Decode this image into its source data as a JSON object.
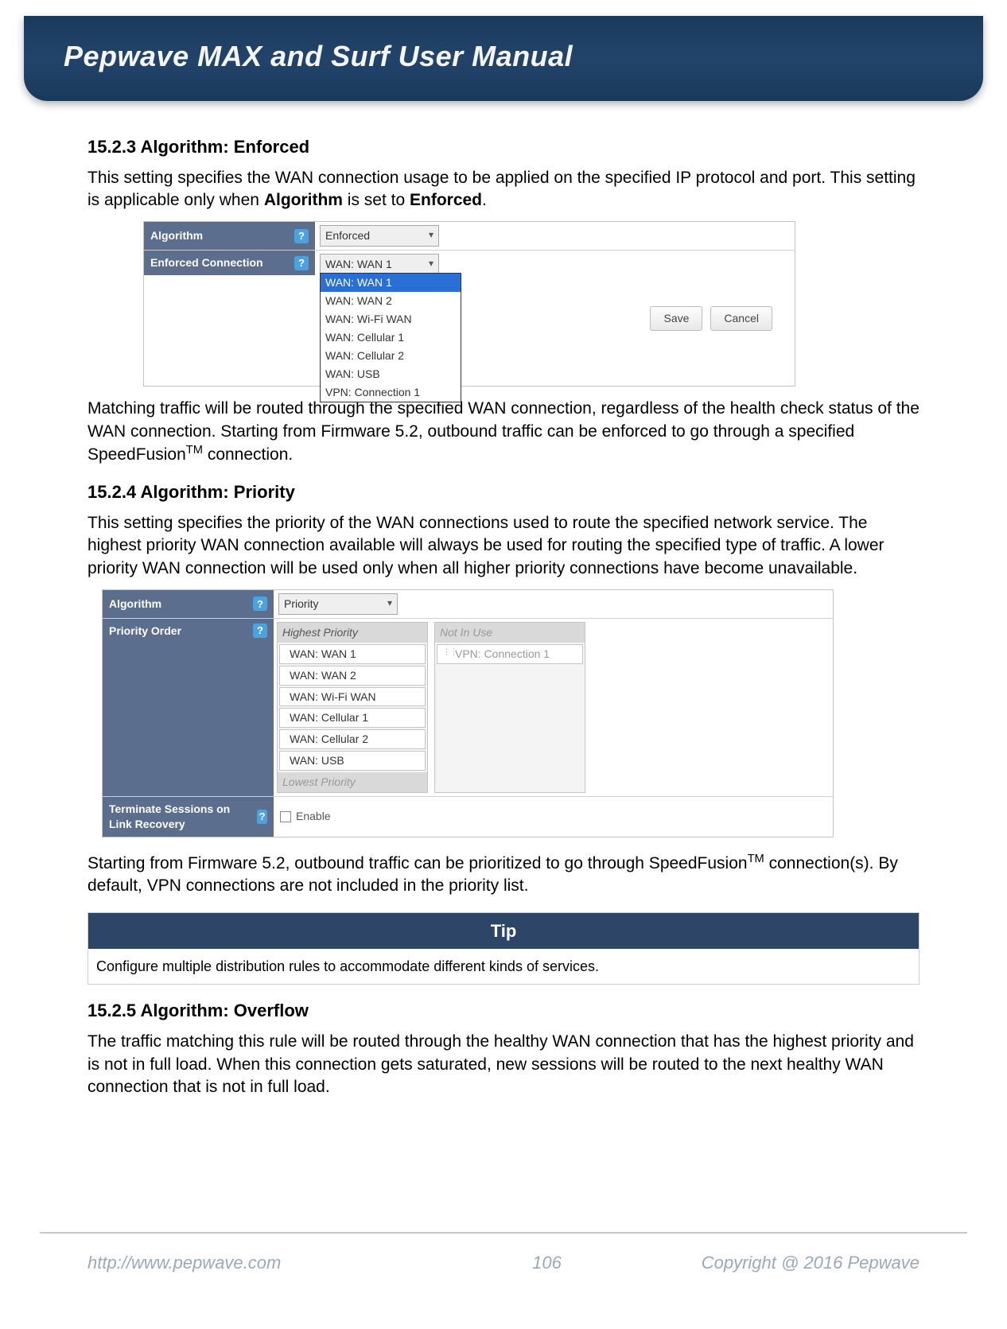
{
  "header": {
    "title": "Pepwave MAX and Surf User Manual"
  },
  "sections": {
    "s1": {
      "heading": "15.2.3 Algorithm: Enforced",
      "p1a": "This setting specifies the WAN connection usage to be applied on the specified IP protocol and port. This setting is applicable only when ",
      "p1b": "Algorithm",
      "p1c": " is set to ",
      "p1d": "Enforced",
      "p1e": ".",
      "p2a": "Matching traffic will be routed through the specified WAN connection, regardless of the health check status of the WAN connection. Starting from Firmware 5.2, outbound traffic can be enforced to go through a specified SpeedFusion",
      "p2b": " connection."
    },
    "s2": {
      "heading": "15.2.4 Algorithm: Priority",
      "p1": "This setting specifies the priority of the WAN connections used to route the specified network service. The highest priority WAN connection available will always be used for routing the specified type of traffic. A lower priority WAN connection will be used only when all higher priority connections have become unavailable.",
      "p2a": "Starting from Firmware 5.2, outbound traffic can be prioritized to go through SpeedFusion",
      "p2b": " connection(s). By default, VPN connections are not included in the priority list."
    },
    "s3": {
      "heading": "15.2.5 Algorithm: Overflow",
      "p1": "The traffic matching this rule will be routed through the healthy WAN connection that has the highest priority and is not in full load. When this connection gets saturated, new sessions will be routed to the next healthy WAN connection that is not in full load."
    }
  },
  "shot1": {
    "row_algo": "Algorithm",
    "row_enf": "Enforced Connection",
    "algo_value": "Enforced",
    "enf_value": "WAN: WAN 1",
    "options": [
      "WAN: WAN 1",
      "WAN: WAN 2",
      "WAN: Wi-Fi WAN",
      "WAN: Cellular 1",
      "WAN: Cellular 2",
      "WAN: USB",
      "VPN: Connection 1"
    ],
    "save": "Save",
    "cancel": "Cancel",
    "help_glyph": "?"
  },
  "shot2": {
    "row_algo": "Algorithm",
    "algo_value": "Priority",
    "row_prio": "Priority Order",
    "highest": "Highest Priority",
    "lowest": "Lowest Priority",
    "notinuse": "Not In Use",
    "items": [
      "WAN: WAN 1",
      "WAN: WAN 2",
      "WAN: Wi-Fi WAN",
      "WAN: Cellular 1",
      "WAN: Cellular 2",
      "WAN: USB"
    ],
    "niu_items": [
      "VPN: Connection 1"
    ],
    "row_term": "Terminate Sessions on Link Recovery",
    "enable": "Enable"
  },
  "tip": {
    "title": "Tip",
    "body": "Configure multiple distribution rules to accommodate different kinds of services."
  },
  "tm": "TM",
  "footer": {
    "url": "http://www.pepwave.com",
    "page": "106",
    "copyright": "Copyright @ 2016 Pepwave"
  }
}
